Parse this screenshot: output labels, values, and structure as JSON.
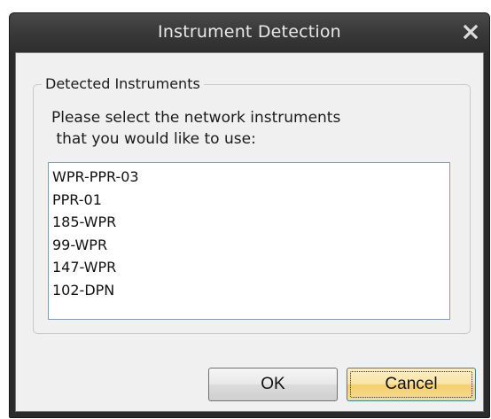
{
  "window": {
    "title": "Instrument Detection",
    "close_glyph": "X",
    "close_icon": "close-icon"
  },
  "group": {
    "legend": "Detected Instruments",
    "prompt": "Please select the network instruments\n that you would like to use:"
  },
  "instruments": [
    "WPR-PPR-03",
    "PPR-01",
    "185-WPR",
    "99-WPR",
    "147-WPR",
    "102-DPN"
  ],
  "buttons": {
    "ok_label": "OK",
    "cancel_label": "Cancel"
  },
  "colors": {
    "titlebar": "#3a3a3a",
    "client_bg": "#f0f0f0",
    "default_button": "#f9e4a6",
    "listbox_border": "#7f9db9"
  }
}
